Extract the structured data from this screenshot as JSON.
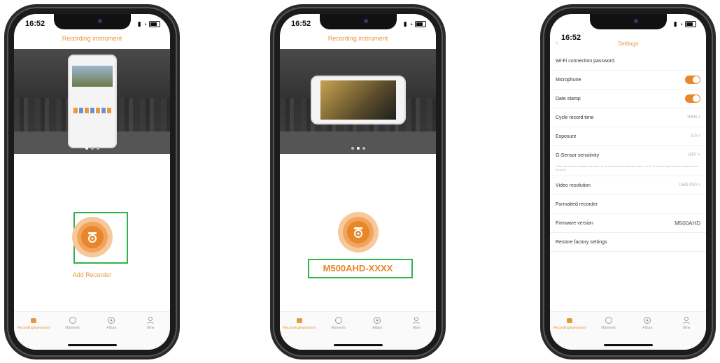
{
  "status_time": "16:52",
  "app_title": "Recording instrument",
  "screen1": {
    "add_label": "Add Recorder"
  },
  "screen2": {
    "device_id": "M500AHD-XXXX"
  },
  "screen3": {
    "header": "Settings",
    "rows": [
      {
        "label": "Wi-Fi connection password",
        "value": ""
      },
      {
        "label": "Microphone",
        "value": ""
      },
      {
        "label": "Date stamp",
        "value": ""
      },
      {
        "label": "Cycle record time",
        "value": "1MIN >"
      },
      {
        "label": "Exposure",
        "value": "0.0 >"
      },
      {
        "label": "G-Sensor sensitivity",
        "value": "OFF >"
      },
      {
        "label": "Video resolution",
        "value": "UHD P30 >"
      },
      {
        "label": "Formatted recorder",
        "value": ""
      },
      {
        "label": "Firmware version",
        "value": "M500AHD"
      },
      {
        "label": "Restore factory settings",
        "value": ""
      }
    ],
    "gsensor_note": "When the vehicle collides, the video is not covered automatically when it is hit. It is used to provide the basis for the accident"
  },
  "tabs": [
    "Recordinginstrument",
    "Moments",
    "Album",
    "Mine"
  ],
  "colors": {
    "accent": "#e8862a",
    "highlight": "#2fb34a"
  }
}
